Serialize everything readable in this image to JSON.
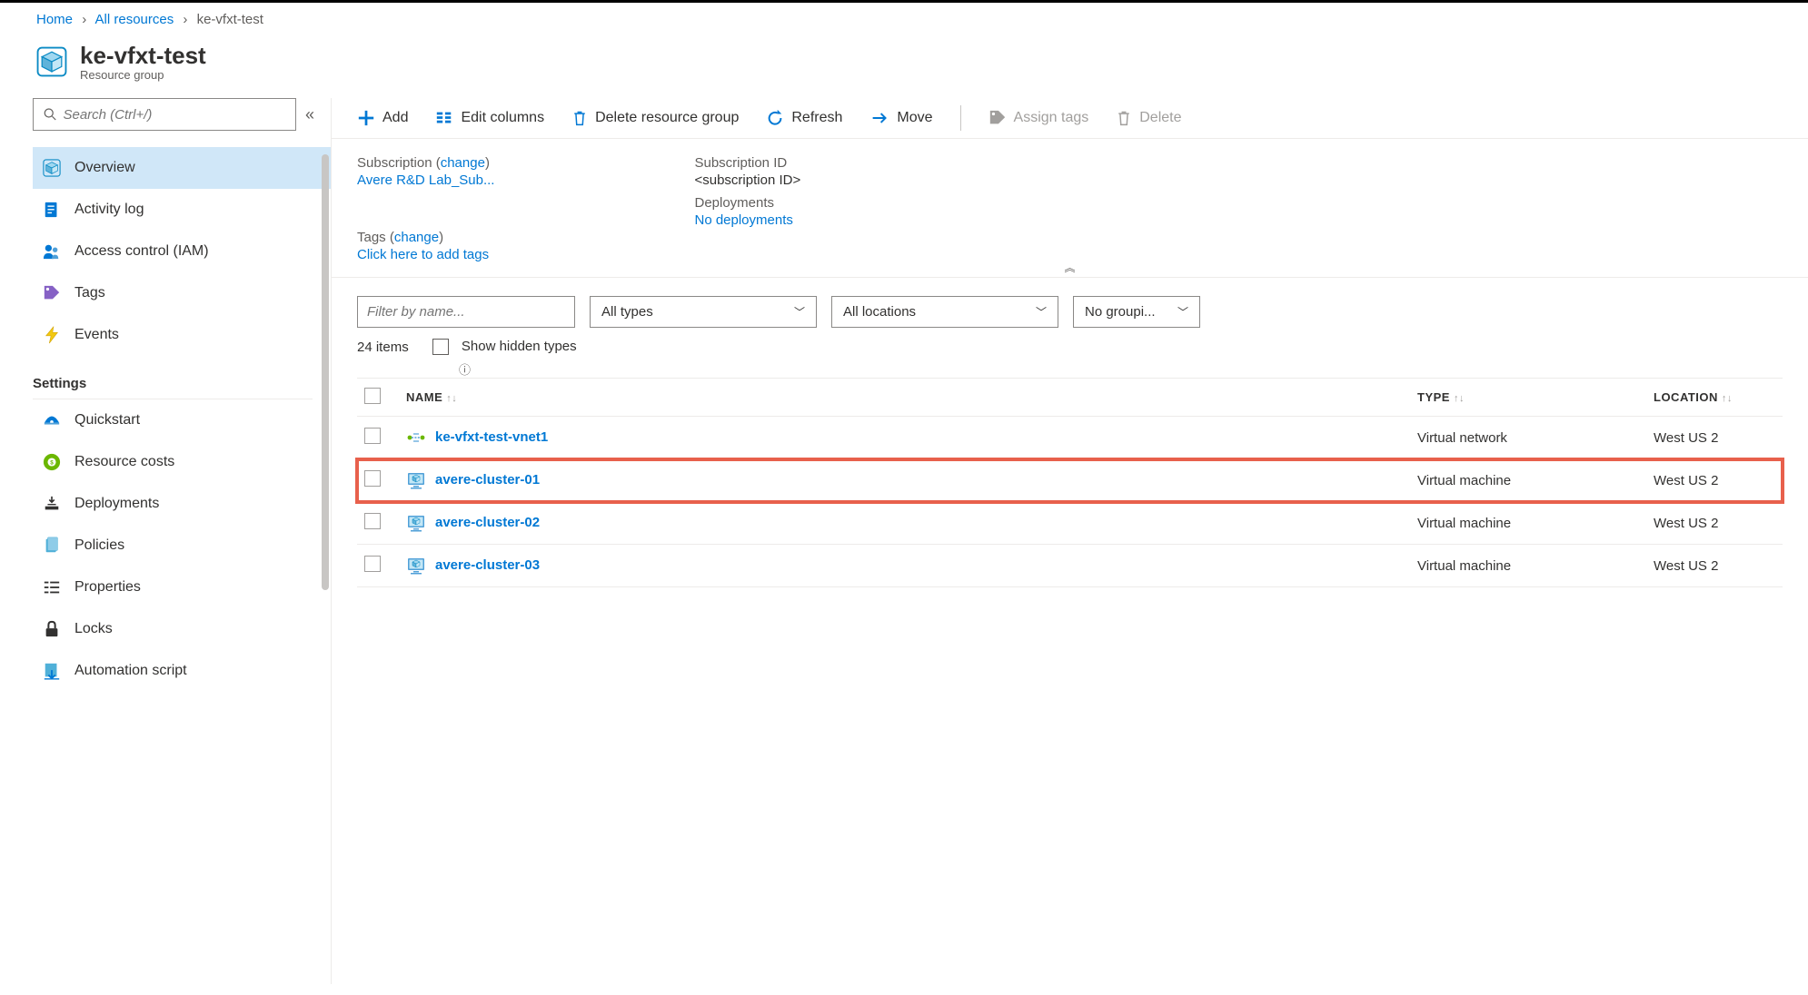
{
  "breadcrumb": {
    "home": "Home",
    "all_resources": "All resources",
    "current": "ke-vfxt-test"
  },
  "header": {
    "title": "ke-vfxt-test",
    "subtitle": "Resource group"
  },
  "sidebar": {
    "search_placeholder": "Search (Ctrl+/)",
    "items": [
      {
        "label": "Overview"
      },
      {
        "label": "Activity log"
      },
      {
        "label": "Access control (IAM)"
      },
      {
        "label": "Tags"
      },
      {
        "label": "Events"
      }
    ],
    "settings_label": "Settings",
    "settings_items": [
      {
        "label": "Quickstart"
      },
      {
        "label": "Resource costs"
      },
      {
        "label": "Deployments"
      },
      {
        "label": "Policies"
      },
      {
        "label": "Properties"
      },
      {
        "label": "Locks"
      },
      {
        "label": "Automation script"
      }
    ]
  },
  "toolbar": {
    "add": "Add",
    "edit_columns": "Edit columns",
    "delete_rg": "Delete resource group",
    "refresh": "Refresh",
    "move": "Move",
    "assign_tags": "Assign tags",
    "delete": "Delete"
  },
  "essentials": {
    "subscription_label": "Subscription",
    "change": "change",
    "subscription_value": "Avere R&D Lab_Sub...",
    "subscription_id_label": "Subscription ID",
    "subscription_id_value": "<subscription ID>",
    "deployments_label": "Deployments",
    "deployments_value": "No deployments",
    "tags_label": "Tags",
    "tags_value": "Click here to add tags"
  },
  "filters": {
    "filter_placeholder": "Filter by name...",
    "types": "All types",
    "locations": "All locations",
    "grouping": "No groupi..."
  },
  "list": {
    "count": "24 items",
    "show_hidden": "Show hidden types"
  },
  "table": {
    "headers": {
      "name": "NAME",
      "type": "TYPE",
      "location": "LOCATION"
    },
    "rows": [
      {
        "icon": "vnet",
        "name": "ke-vfxt-test-vnet1",
        "type": "Virtual network",
        "location": "West US 2"
      },
      {
        "icon": "vm",
        "name": "avere-cluster-01",
        "type": "Virtual machine",
        "location": "West US 2",
        "highlighted": true
      },
      {
        "icon": "vm",
        "name": "avere-cluster-02",
        "type": "Virtual machine",
        "location": "West US 2"
      },
      {
        "icon": "vm",
        "name": "avere-cluster-03",
        "type": "Virtual machine",
        "location": "West US 2"
      }
    ]
  }
}
